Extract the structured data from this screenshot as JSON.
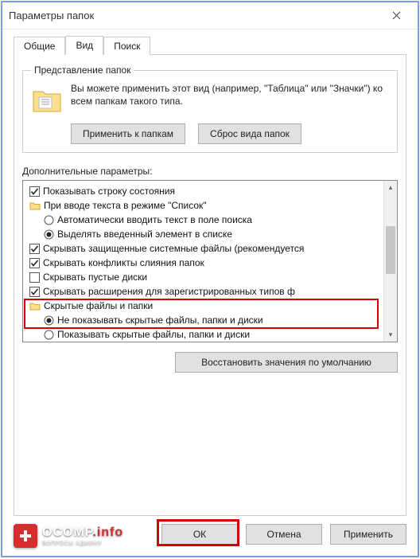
{
  "window": {
    "title": "Параметры папок"
  },
  "tabs": {
    "general": "Общие",
    "view": "Вид",
    "search": "Поиск"
  },
  "groupbox": {
    "title": "Представление папок",
    "text": "Вы можете применить этот вид (например, \"Таблица\" или \"Значки\") ко всем папкам такого типа.",
    "btn_apply": "Применить к папкам",
    "btn_reset": "Сброс вида папок"
  },
  "advanced": {
    "label": "Дополнительные параметры:"
  },
  "tree": [
    {
      "type": "check",
      "checked": true,
      "level": 0,
      "label": "Показывать строку состояния"
    },
    {
      "type": "folder",
      "level": 0,
      "label": "При вводе текста в режиме \"Список\""
    },
    {
      "type": "radio",
      "checked": false,
      "level": 1,
      "label": "Автоматически вводить текст в поле поиска"
    },
    {
      "type": "radio",
      "checked": true,
      "level": 1,
      "label": "Выделять введенный элемент в списке"
    },
    {
      "type": "check",
      "checked": true,
      "level": 0,
      "label": "Скрывать защищенные системные файлы (рекомендуется"
    },
    {
      "type": "check",
      "checked": true,
      "level": 0,
      "label": "Скрывать конфликты слияния папок"
    },
    {
      "type": "check",
      "checked": false,
      "level": 0,
      "label": "Скрывать пустые диски"
    },
    {
      "type": "check",
      "checked": true,
      "level": 0,
      "label": "Скрывать расширения для зарегистрированных типов ф"
    },
    {
      "type": "folder",
      "level": 0,
      "label": "Скрытые файлы и папки"
    },
    {
      "type": "radio",
      "checked": true,
      "level": 1,
      "label": "Не показывать скрытые файлы, папки и диски"
    },
    {
      "type": "radio",
      "checked": false,
      "level": 1,
      "label": "Показывать скрытые файлы, папки и диски"
    }
  ],
  "restore_btn": "Восстановить значения по умолчанию",
  "buttons": {
    "ok": "ОК",
    "cancel": "Отмена",
    "apply": "Применить"
  },
  "overlay": {
    "brand_main": "OCOMP",
    "brand_suffix": ".info",
    "brand_sub": "ВОПРОСЫ АДМИНУ"
  }
}
